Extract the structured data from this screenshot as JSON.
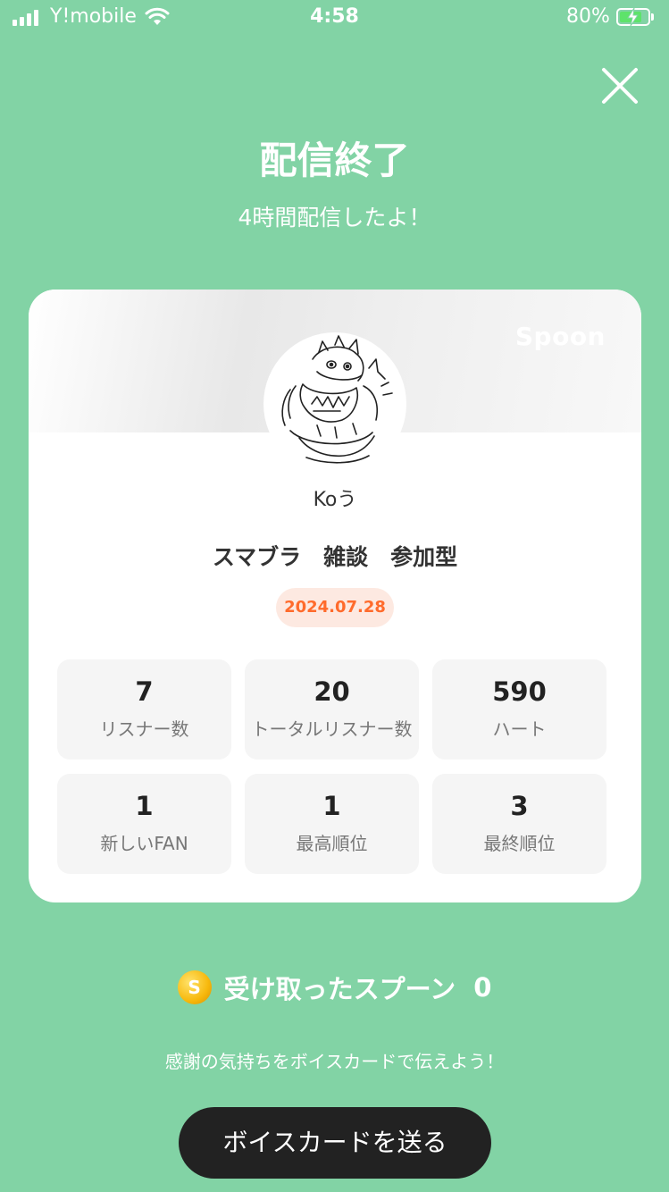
{
  "status_bar": {
    "carrier": "Y!mobile",
    "time": "4:58",
    "battery_percent": "80%",
    "battery_level": 0.8,
    "charging": true
  },
  "header": {
    "title": "配信終了",
    "subtitle": "4時間配信したよ！"
  },
  "card": {
    "brand": "Spoon",
    "username": "Koう",
    "stream_title": "スマブラ　雑談　参加型",
    "date": "2024.07.28",
    "stats": [
      {
        "value": "7",
        "label": "リスナー数"
      },
      {
        "value": "20",
        "label": "トータルリスナー数"
      },
      {
        "value": "590",
        "label": "ハート"
      },
      {
        "value": "1",
        "label": "新しいFAN"
      },
      {
        "value": "1",
        "label": "最高順位"
      },
      {
        "value": "3",
        "label": "最終順位"
      }
    ]
  },
  "spoons": {
    "icon": "spoon-coin-icon",
    "coin_letter": "S",
    "label": "受け取ったスプーン",
    "count": "0"
  },
  "thanks_text": "感謝の気持ちをボイスカードで伝えよう！",
  "cta_label": "ボイスカードを送る",
  "colors": {
    "background": "#82d3a5",
    "date_text": "#ff6b2c",
    "date_bg": "#fde9e1",
    "button": "#222222"
  }
}
